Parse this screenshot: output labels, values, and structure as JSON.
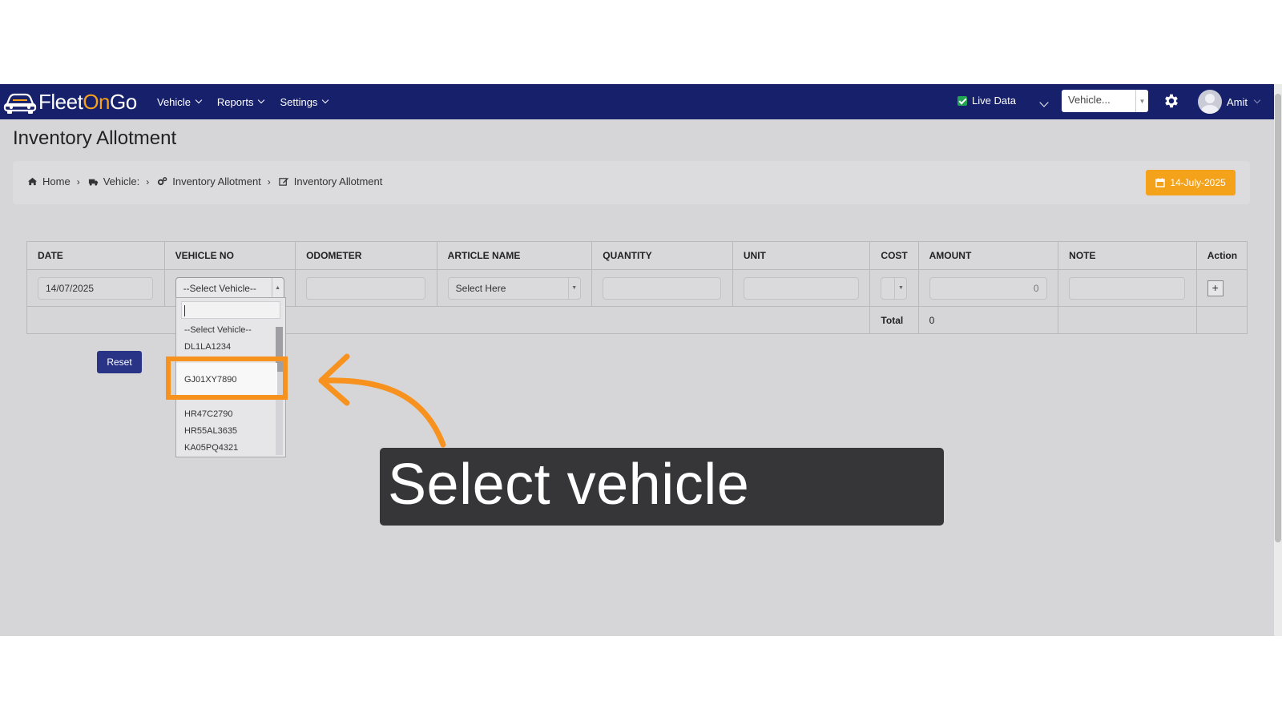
{
  "navbar": {
    "logo": {
      "fleet": "Fleet",
      "on": "On",
      "go": "Go"
    },
    "menu": [
      {
        "label": "Vehicle"
      },
      {
        "label": "Reports"
      },
      {
        "label": "Settings"
      }
    ],
    "live_data_label": "Live Data",
    "live_data_checked": true,
    "vehicle_select_value": "Vehicle...",
    "user_name": "Amit"
  },
  "page_title": "Inventory Allotment",
  "breadcrumb": [
    {
      "label": "Home",
      "icon": "home-icon"
    },
    {
      "label": "Vehicle:",
      "icon": "truck-icon"
    },
    {
      "label": "Inventory Allotment",
      "icon": "cogs-icon"
    },
    {
      "label": "Inventory Allotment",
      "icon": "edit-icon"
    }
  ],
  "date_badge": "14-July-2025",
  "table": {
    "headers": [
      "DATE",
      "VEHICLE NO",
      "ODOMETER",
      "ARTICLE NAME",
      "QUANTITY",
      "UNIT",
      "COST",
      "AMOUNT",
      "NOTE",
      "Action"
    ],
    "row": {
      "date": "14/07/2025",
      "vehicle_no": "--Select Vehicle--",
      "odometer": "",
      "article_name": "Select Here",
      "quantity": "",
      "unit": "",
      "cost": "",
      "amount": "0",
      "note": "",
      "action": "+"
    },
    "total_label": "Total",
    "total_value": "0"
  },
  "reset_label": "Reset",
  "vehicle_dropdown": {
    "search_value": "",
    "options": [
      "--Select Vehicle--",
      "DL1LA1234",
      "GJ01XY7890",
      "HR47C2790",
      "HR55AL3635",
      "KA05PQ4321"
    ],
    "highlighted": "GJ01XY7890"
  },
  "callout_text": "Select vehicle",
  "colors": {
    "navbar": "#17206b",
    "accent_orange": "#f5a21b",
    "highlight_box": "#f7921e",
    "reset_button": "#2a3486",
    "callout_bg": "#363638"
  }
}
